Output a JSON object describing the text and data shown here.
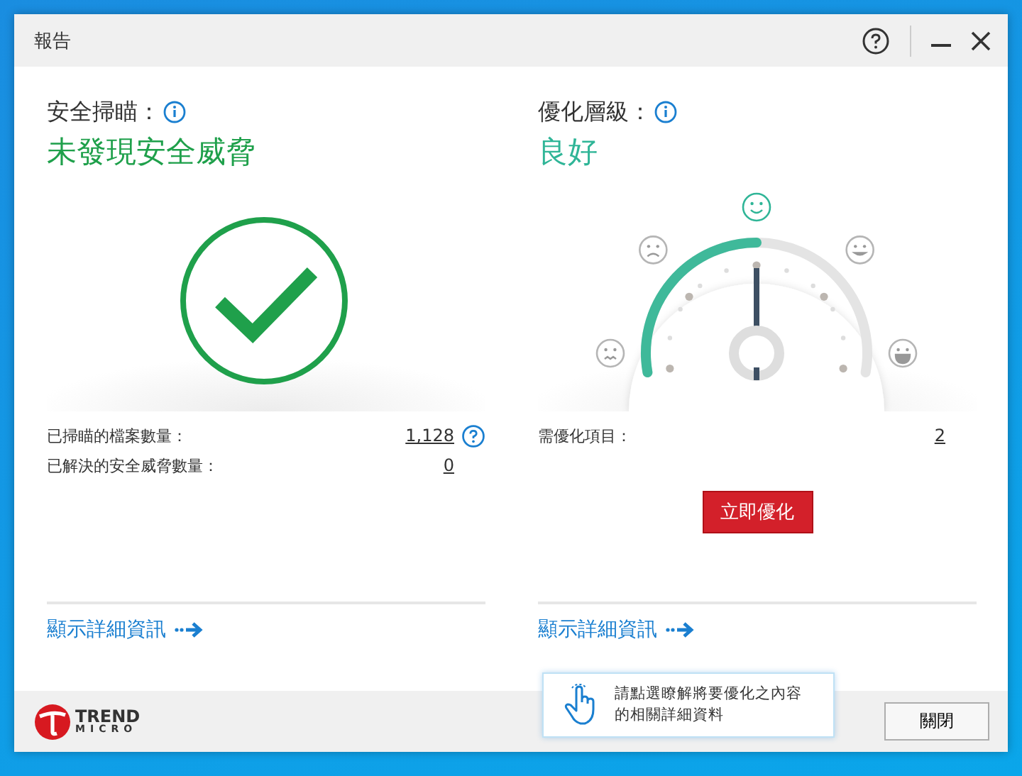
{
  "window": {
    "title": "報告"
  },
  "scan": {
    "label": "安全掃瞄：",
    "status": "未發現安全威脅",
    "stats": [
      {
        "label": "已掃瞄的檔案數量：",
        "value": "1,128",
        "help": true
      },
      {
        "label": "已解決的安全威脅數量：",
        "value": "0",
        "help": false
      }
    ],
    "link": "顯示詳細資訊"
  },
  "optimization": {
    "label": "優化層級：",
    "status": "良好",
    "gauge": {
      "level": 0.5,
      "faces": [
        {
          "kind": "angry",
          "selected": false
        },
        {
          "kind": "sad",
          "selected": false
        },
        {
          "kind": "smile",
          "selected": true
        },
        {
          "kind": "happy",
          "selected": false
        },
        {
          "kind": "grin",
          "selected": false
        }
      ]
    },
    "stats": [
      {
        "label": "需優化項目：",
        "value": "2",
        "help": false
      }
    ],
    "button": "立即優化",
    "link": "顯示詳細資訊",
    "tooltip": "請點選瞭解將要優化之內容的相關詳細資料"
  },
  "footer": {
    "logo_top": "TREND",
    "logo_bottom": "MICRO",
    "close_button": "關閉"
  }
}
